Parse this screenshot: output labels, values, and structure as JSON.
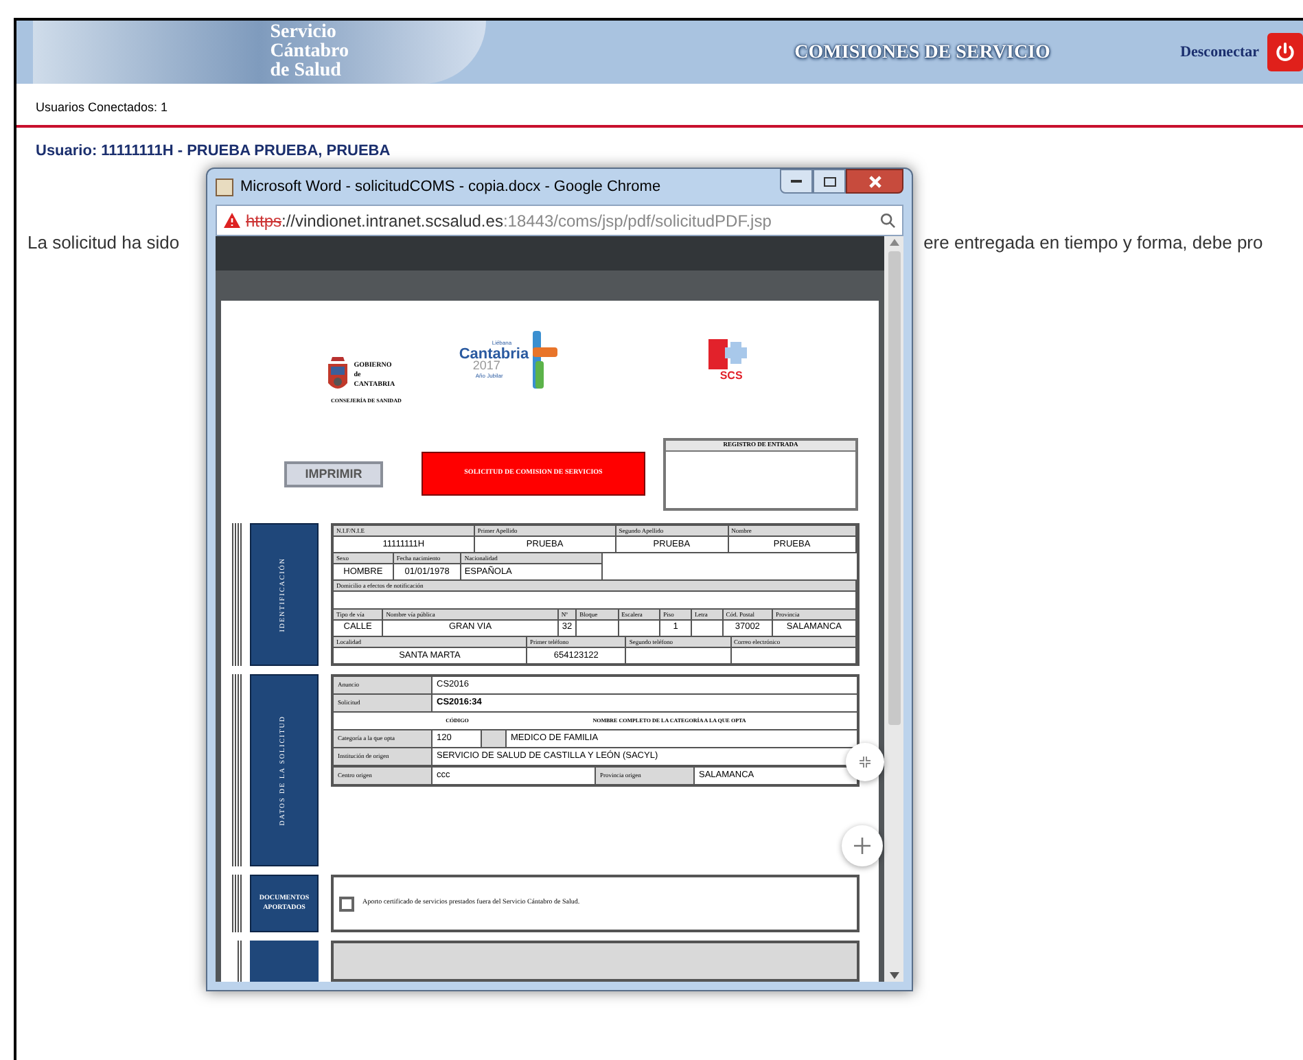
{
  "header": {
    "logo_lines": [
      "Servicio",
      "Cántabro",
      "de Salud"
    ],
    "title": "COMISIONES DE SERVICIO",
    "logout": "Desconectar"
  },
  "connected_users": "Usuarios Conectados: 1",
  "user": "Usuario: 11111111H - PRUEBA PRUEBA, PRUEBA",
  "message_parts": [
    "La solicitud ha sido",
    "ere entregada en tiempo y forma, debe pro"
  ],
  "popup": {
    "title": "Microsoft Word - solicitudCOMS - copia.docx - Google Chrome",
    "url_scheme": "https",
    "url_host": "://vindionet.intranet.scsalud.es",
    "url_path": ":18443/coms/jsp/pdf/solicitudPDF.jsp",
    "document": {
      "gobierno_lines": [
        "GOBIERNO",
        "de",
        "CANTABRIA"
      ],
      "consejeria": "CONSEJERÍA DE SANIDAD",
      "jubilee_lines": [
        "Liébana",
        "Cantabria",
        "2017",
        "Año Jubilar"
      ],
      "scs": "SCS",
      "print_button": "IMPRIMIR",
      "form_title": "SOLICITUD DE COMISION DE SERVICIOS",
      "register": "REGISTRO DE ENTRADA",
      "identification": {
        "title": "IDENTIFICACIÓN",
        "rows": [
          [
            {
              "label": "N.I.F/N.I.E",
              "value": "11111111H"
            },
            {
              "label": "Primer Apellido",
              "value": "PRUEBA"
            },
            {
              "label": "Segundo Apellido",
              "value": "PRUEBA"
            },
            {
              "label": "Nombre",
              "value": "PRUEBA"
            }
          ],
          [
            {
              "label": "Sexo",
              "value": "HOMBRE"
            },
            {
              "label": "Fecha nacimiento",
              "value": "01/01/1978"
            },
            {
              "label": "Nacionalidad",
              "value": "ESPAÑOLA"
            }
          ],
          [
            {
              "label": "Domicilio a efectos de notificación"
            }
          ],
          [
            {
              "label": "Tipo de vía",
              "value": "CALLE"
            },
            {
              "label": "Nombre vía pública",
              "value": "GRAN VIA"
            },
            {
              "label": "Nº",
              "value": "32"
            },
            {
              "label": "Bloque"
            },
            {
              "label": "Escalera"
            },
            {
              "label": "Piso",
              "value": "1"
            },
            {
              "label": "Letra"
            },
            {
              "label": "Cód. Postal",
              "value": "37002"
            },
            {
              "label": "Provincia",
              "value": "SALAMANCA"
            }
          ],
          [
            {
              "label": "Localidad",
              "value": "SANTA MARTA"
            },
            {
              "label": "Primer teléfono",
              "value": "654123122"
            },
            {
              "label": "Segundo teléfono"
            },
            {
              "label": "Correo electrónico"
            }
          ]
        ]
      },
      "request": {
        "title": "DATOS DE LA SOLICITUD",
        "rows": [
          [
            {
              "kind": "label",
              "text": "Anuncio"
            },
            {
              "kind": "value",
              "text": "CS2016",
              "bold": false
            }
          ],
          [
            {
              "kind": "label",
              "text": "Solicitud"
            },
            {
              "kind": "value",
              "text": "CS2016:34",
              "bold": true
            }
          ],
          [
            {
              "kind": "blank"
            },
            {
              "kind": "code_heading",
              "text": "CÓDIGO"
            },
            {
              "kind": "heading",
              "text": "NOMBRE COMPLETO DE LA CATEGORÍA A LA QUE OPTA"
            }
          ],
          [
            {
              "kind": "label",
              "text": "Categoría a la que opta"
            },
            {
              "kind": "code",
              "text": "120"
            },
            {
              "kind": "shaded"
            },
            {
              "kind": "value",
              "text": "MEDICO DE FAMILIA",
              "bold": false
            }
          ],
          [
            {
              "kind": "label",
              "text": "Institución de origen"
            },
            {
              "kind": "value",
              "text": "SERVICIO DE SALUD DE CASTILLA Y LEÓN (SACYL)",
              "bold": false
            }
          ]
        ],
        "origin": {
          "centre_label": "Centro origen",
          "centre": "ccc",
          "province_label": "Provincia origen",
          "province": "SALAMANCA"
        }
      },
      "documents": {
        "title": "DOCUMENTOS APORTADOS",
        "checked": false,
        "text": "Aporto certificado de servicios prestados fuera del Servicio Cántabro de Salud."
      }
    }
  }
}
